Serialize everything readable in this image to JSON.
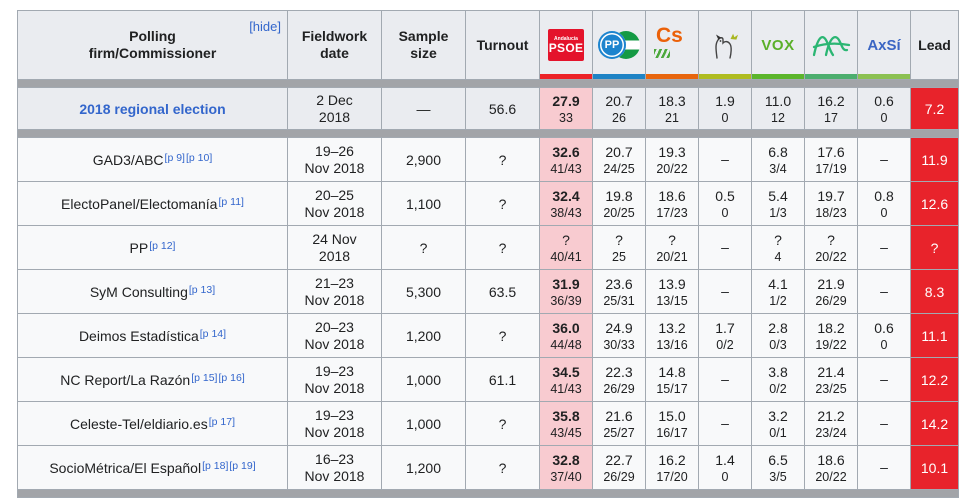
{
  "table": {
    "header": {
      "polling_firm_label": "Polling\nfirm/Commissioner",
      "hide_label": "[hide]",
      "fieldwork_label": "Fieldwork\ndate",
      "sample_label": "Sample\nsize",
      "turnout_label": "Turnout",
      "lead_label": "Lead",
      "parties": [
        {
          "id": "psoe",
          "name": "PSOE",
          "logo_top": "Andalucía",
          "logo_text": "PSOE",
          "color": "#ec2227"
        },
        {
          "id": "pp",
          "name": "PP",
          "logo_text": "PP",
          "color": "#1e83c5"
        },
        {
          "id": "cs",
          "name": "Cs",
          "logo_text": "Cs",
          "color": "#e8650d"
        },
        {
          "id": "pacma",
          "name": "PACMA",
          "logo_text": "",
          "color": "#afbc20"
        },
        {
          "id": "vox",
          "name": "VOX",
          "logo_text": "VOX",
          "color": "#5bb52b"
        },
        {
          "id": "aa",
          "name": "Adelante Andalucía",
          "logo_text": "",
          "color": "#4cae6e"
        },
        {
          "id": "axsi",
          "name": "AxSí",
          "logo_text": "AxSí",
          "color": "#8cc152"
        }
      ]
    },
    "rows": [
      {
        "firm": "2018 regional election",
        "is_election": true,
        "refs": [],
        "date": "2 Dec\n2018",
        "sample": "—",
        "turnout": "56.6",
        "results": [
          {
            "v": "27.9",
            "s": "33",
            "hl": true,
            "b": true
          },
          {
            "v": "20.7",
            "s": "26"
          },
          {
            "v": "18.3",
            "s": "21"
          },
          {
            "v": "1.9",
            "s": "0"
          },
          {
            "v": "11.0",
            "s": "12"
          },
          {
            "v": "16.2",
            "s": "17"
          },
          {
            "v": "0.6",
            "s": "0"
          }
        ],
        "lead": "7.2"
      },
      {
        "firm": "GAD3/ABC",
        "refs": [
          "[p 9]",
          "[p 10]"
        ],
        "date": "19–26\nNov 2018",
        "sample": "2,900",
        "turnout": "?",
        "results": [
          {
            "v": "32.6",
            "s": "41/43",
            "hl": true,
            "b": true
          },
          {
            "v": "20.7",
            "s": "24/25"
          },
          {
            "v": "19.3",
            "s": "20/22"
          },
          {
            "v": "–",
            "s": ""
          },
          {
            "v": "6.8",
            "s": "3/4"
          },
          {
            "v": "17.6",
            "s": "17/19"
          },
          {
            "v": "–",
            "s": ""
          }
        ],
        "lead": "11.9"
      },
      {
        "firm": "ElectoPanel/Electomanía",
        "refs": [
          "[p 11]"
        ],
        "date": "20–25\nNov 2018",
        "sample": "1,100",
        "turnout": "?",
        "results": [
          {
            "v": "32.4",
            "s": "38/43",
            "hl": true,
            "b": true
          },
          {
            "v": "19.8",
            "s": "20/25"
          },
          {
            "v": "18.6",
            "s": "17/23"
          },
          {
            "v": "0.5",
            "s": "0"
          },
          {
            "v": "5.4",
            "s": "1/3"
          },
          {
            "v": "19.7",
            "s": "18/23"
          },
          {
            "v": "0.8",
            "s": "0"
          }
        ],
        "lead": "12.6"
      },
      {
        "firm": "PP",
        "refs": [
          "[p 12]"
        ],
        "date": "24 Nov\n2018",
        "sample": "?",
        "turnout": "?",
        "results": [
          {
            "v": "?",
            "s": "40/41",
            "hl": true
          },
          {
            "v": "?",
            "s": "25"
          },
          {
            "v": "?",
            "s": "20/21"
          },
          {
            "v": "–",
            "s": ""
          },
          {
            "v": "?",
            "s": "4"
          },
          {
            "v": "?",
            "s": "20/22"
          },
          {
            "v": "–",
            "s": ""
          }
        ],
        "lead": "?"
      },
      {
        "firm": "SyM Consulting",
        "refs": [
          "[p 13]"
        ],
        "date": "21–23\nNov 2018",
        "sample": "5,300",
        "turnout": "63.5",
        "results": [
          {
            "v": "31.9",
            "s": "36/39",
            "hl": true,
            "b": true
          },
          {
            "v": "23.6",
            "s": "25/31"
          },
          {
            "v": "13.9",
            "s": "13/15"
          },
          {
            "v": "–",
            "s": ""
          },
          {
            "v": "4.1",
            "s": "1/2"
          },
          {
            "v": "21.9",
            "s": "26/29"
          },
          {
            "v": "–",
            "s": ""
          }
        ],
        "lead": "8.3"
      },
      {
        "firm": "Deimos Estadística",
        "refs": [
          "[p 14]"
        ],
        "date": "20–23\nNov 2018",
        "sample": "1,200",
        "turnout": "?",
        "results": [
          {
            "v": "36.0",
            "s": "44/48",
            "hl": true,
            "b": true
          },
          {
            "v": "24.9",
            "s": "30/33"
          },
          {
            "v": "13.2",
            "s": "13/16"
          },
          {
            "v": "1.7",
            "s": "0/2"
          },
          {
            "v": "2.8",
            "s": "0/3"
          },
          {
            "v": "18.2",
            "s": "19/22"
          },
          {
            "v": "0.6",
            "s": "0"
          }
        ],
        "lead": "11.1"
      },
      {
        "firm": "NC Report/La Razón",
        "refs": [
          "[p 15]",
          "[p 16]"
        ],
        "date": "19–23\nNov 2018",
        "sample": "1,000",
        "turnout": "61.1",
        "results": [
          {
            "v": "34.5",
            "s": "41/43",
            "hl": true,
            "b": true
          },
          {
            "v": "22.3",
            "s": "26/29"
          },
          {
            "v": "14.8",
            "s": "15/17"
          },
          {
            "v": "–",
            "s": ""
          },
          {
            "v": "3.8",
            "s": "0/2"
          },
          {
            "v": "21.4",
            "s": "23/25"
          },
          {
            "v": "–",
            "s": ""
          }
        ],
        "lead": "12.2"
      },
      {
        "firm": "Celeste-Tel/eldiario.es",
        "refs": [
          "[p 17]"
        ],
        "date": "19–23\nNov 2018",
        "sample": "1,000",
        "turnout": "?",
        "results": [
          {
            "v": "35.8",
            "s": "43/45",
            "hl": true,
            "b": true
          },
          {
            "v": "21.6",
            "s": "25/27"
          },
          {
            "v": "15.0",
            "s": "16/17"
          },
          {
            "v": "–",
            "s": ""
          },
          {
            "v": "3.2",
            "s": "0/1"
          },
          {
            "v": "21.2",
            "s": "23/24"
          },
          {
            "v": "–",
            "s": ""
          }
        ],
        "lead": "14.2"
      },
      {
        "firm": "SocioMétrica/El Español",
        "refs": [
          "[p 18]",
          "[p 19]"
        ],
        "date": "16–23\nNov 2018",
        "sample": "1,200",
        "turnout": "?",
        "results": [
          {
            "v": "32.8",
            "s": "37/40",
            "hl": true,
            "b": true
          },
          {
            "v": "22.7",
            "s": "26/29"
          },
          {
            "v": "16.2",
            "s": "17/20"
          },
          {
            "v": "1.4",
            "s": "0"
          },
          {
            "v": "6.5",
            "s": "3/5"
          },
          {
            "v": "18.6",
            "s": "20/22"
          },
          {
            "v": "–",
            "s": ""
          }
        ],
        "lead": "10.1"
      }
    ]
  }
}
